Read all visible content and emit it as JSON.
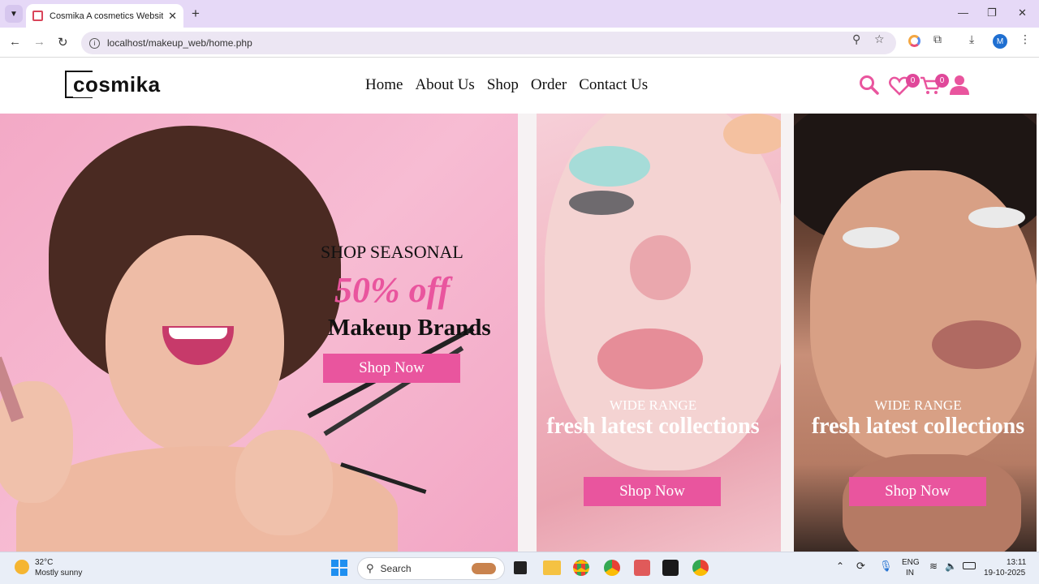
{
  "browser": {
    "tab_title": "Cosmika A cosmetics Website T",
    "url": "localhost/makeup_web/home.php",
    "profile_initial": "M"
  },
  "site": {
    "logo": "cosmika",
    "nav": [
      "Home",
      "About Us",
      "Shop",
      "Order",
      "Contact Us"
    ],
    "wishlist_count": "0",
    "cart_count": "0",
    "accent_color": "#e9559e"
  },
  "hero": {
    "main": {
      "kicker": "SHOP SEASONAL",
      "offer": "50% off",
      "headline": "Makeup Brands",
      "button": "Shop Now"
    },
    "card2": {
      "kicker": "WIDE RANGE",
      "headline": "fresh latest collections",
      "button": "Shop Now"
    },
    "card3": {
      "kicker": "WIDE RANGE",
      "headline": "fresh latest collections",
      "button": "Shop Now"
    }
  },
  "taskbar": {
    "weather_temp": "32°C",
    "weather_desc": "Mostly sunny",
    "search_placeholder": "Search",
    "lang_top": "ENG",
    "lang_bottom": "IN",
    "time": "13:11",
    "date": "19-10-2025"
  }
}
